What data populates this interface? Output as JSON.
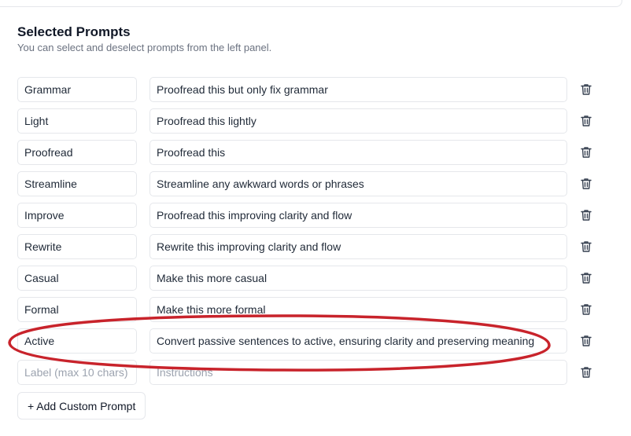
{
  "header": {
    "title": "Selected Prompts",
    "subtitle": "You can select and deselect prompts from the left panel."
  },
  "prompts": [
    {
      "label": "Grammar",
      "instruction": "Proofread this but only fix grammar"
    },
    {
      "label": "Light",
      "instruction": "Proofread this lightly"
    },
    {
      "label": "Proofread",
      "instruction": "Proofread this"
    },
    {
      "label": "Streamline",
      "instruction": "Streamline any awkward words or phrases"
    },
    {
      "label": "Improve",
      "instruction": "Proofread this improving clarity and flow"
    },
    {
      "label": "Rewrite",
      "instruction": "Rewrite this improving clarity and flow"
    },
    {
      "label": "Casual",
      "instruction": "Make this more casual"
    },
    {
      "label": "Formal",
      "instruction": "Make this more formal"
    },
    {
      "label": "Active",
      "instruction": "Convert passive sentences to active, ensuring clarity and preserving meaning"
    }
  ],
  "new_prompt": {
    "label_placeholder": "Label (max 10 chars)",
    "instruction_placeholder": "Instructions"
  },
  "add_button_label": "+ Add Custom Prompt",
  "icons": {
    "delete": "trash-icon"
  },
  "colors": {
    "annotation_circle": "#c8232b",
    "border": "#e5e7eb",
    "muted_text": "#6b7280"
  }
}
